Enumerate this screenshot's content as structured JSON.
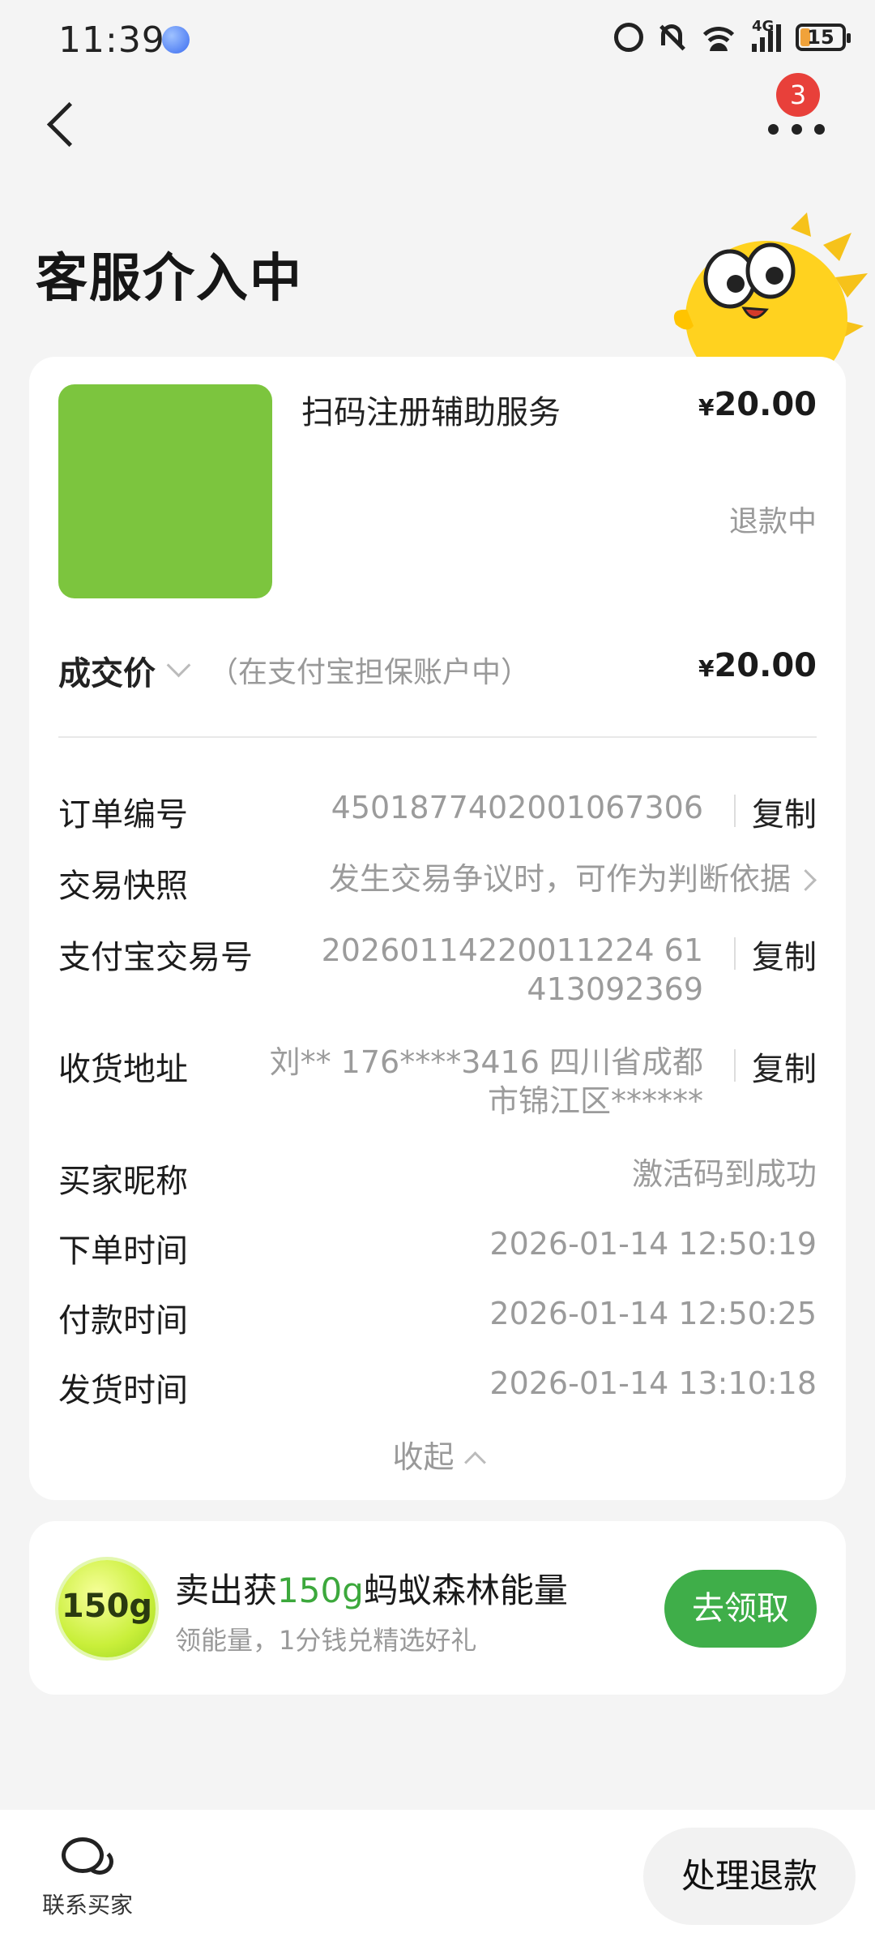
{
  "status": {
    "time": "11:39",
    "network": "4G",
    "battery": "15"
  },
  "nav": {
    "badge_count": "3"
  },
  "page": {
    "title": "客服介入中"
  },
  "product": {
    "name": "扫码注册辅助服务",
    "currency": "¥",
    "price": "20.00",
    "status": "退款中",
    "thumbnail_color": "#7cc53e"
  },
  "deal": {
    "label": "成交价",
    "note": "（在支付宝担保账户中）",
    "currency": "¥",
    "price": "20.00"
  },
  "details": {
    "order_no": {
      "label": "订单编号",
      "value": "4501877402001067306",
      "action": "复制"
    },
    "snapshot": {
      "label": "交易快照",
      "value": "发生交易争议时，可作为判断依据"
    },
    "alipay_no": {
      "label": "支付宝交易号",
      "value_line1": "20260114220011224 61",
      "value_line2": "413092369",
      "action": "复制"
    },
    "address": {
      "label": "收货地址",
      "value_line1": "刘** 176****3416 四川省成都",
      "value_line2": "市锦江区******",
      "action": "复制"
    },
    "buyer": {
      "label": "买家昵称",
      "value": "激活码到成功"
    },
    "order_time": {
      "label": "下单时间",
      "value": "2026-01-14 12:50:19"
    },
    "pay_time": {
      "label": "付款时间",
      "value": "2026-01-14 12:50:25"
    },
    "ship_time": {
      "label": "发货时间",
      "value": "2026-01-14 13:10:18"
    },
    "collapse_label": "收起"
  },
  "promo": {
    "badge": "150g",
    "title_prefix": "卖出获",
    "title_highlight": "150g",
    "title_suffix": "蚂蚁森林能量",
    "subtitle": "领能量，1分钱兑精选好礼",
    "button": "去领取",
    "accent_color": "#3fae49"
  },
  "bottom": {
    "contact_label": "联系买家",
    "process_button": "处理退款"
  }
}
